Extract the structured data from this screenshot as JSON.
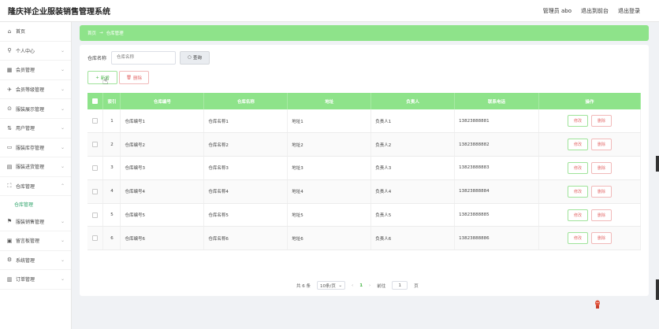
{
  "app": {
    "title": "隆庆祥企业服装销售管理系统"
  },
  "header": {
    "admin": "管理员 abo",
    "front": "退出到前台",
    "logout": "退出登录"
  },
  "sidebar": {
    "items": [
      {
        "icon": "home-icon",
        "glyph": "⌂",
        "label": "首页",
        "arrow": ""
      },
      {
        "icon": "user-icon",
        "glyph": "⚲",
        "label": "个人中心",
        "arrow": "⌄"
      },
      {
        "icon": "members-icon",
        "glyph": "▦",
        "label": "会员管理",
        "arrow": "⌄"
      },
      {
        "icon": "level-icon",
        "glyph": "✈",
        "label": "会员等级管理",
        "arrow": "⌄"
      },
      {
        "icon": "display-icon",
        "glyph": "⊙",
        "label": "服装展示管理",
        "arrow": "⌄"
      },
      {
        "icon": "users-icon",
        "glyph": "⇅",
        "label": "用户管理",
        "arrow": "⌄"
      },
      {
        "icon": "stock-icon",
        "glyph": "▭",
        "label": "服装库存管理",
        "arrow": "⌄"
      },
      {
        "icon": "purchase-icon",
        "glyph": "▤",
        "label": "服装进货管理",
        "arrow": "⌄"
      },
      {
        "icon": "warehouse-icon",
        "glyph": "⛶",
        "label": "仓库管理",
        "arrow": "⌃"
      }
    ],
    "sub_item": "仓库管理",
    "items_after": [
      {
        "icon": "sales-icon",
        "glyph": "⚑",
        "label": "服装销售管理",
        "arrow": "⌄"
      },
      {
        "icon": "message-icon",
        "glyph": "▣",
        "label": "留言板管理",
        "arrow": "⌄"
      },
      {
        "icon": "system-icon",
        "glyph": "⚙",
        "label": "系统管理",
        "arrow": "⌄"
      },
      {
        "icon": "order-icon",
        "glyph": "▥",
        "label": "订单管理",
        "arrow": "⌄"
      }
    ]
  },
  "breadcrumb": {
    "home": "首页",
    "separator": "→",
    "current": "仓库管理"
  },
  "search": {
    "label": "仓库名称",
    "placeholder": "仓库名称",
    "button": "查询"
  },
  "actions": {
    "add": "新增",
    "delete": "删除"
  },
  "table": {
    "headers": [
      "索引",
      "仓库编号",
      "仓库名称",
      "地址",
      "负责人",
      "联系电话",
      "操作"
    ],
    "edit_label": "修改",
    "delete_label": "删除",
    "rows": [
      {
        "index": "1",
        "code": "仓库编号1",
        "name": "仓库名称1",
        "address": "地址1",
        "manager": "负责人1",
        "phone": "13823888881"
      },
      {
        "index": "2",
        "code": "仓库编号2",
        "name": "仓库名称2",
        "address": "地址2",
        "manager": "负责人2",
        "phone": "13823888882"
      },
      {
        "index": "3",
        "code": "仓库编号3",
        "name": "仓库名称3",
        "address": "地址3",
        "manager": "负责人3",
        "phone": "13823888883"
      },
      {
        "index": "4",
        "code": "仓库编号4",
        "name": "仓库名称4",
        "address": "地址4",
        "manager": "负责人4",
        "phone": "13823888884"
      },
      {
        "index": "5",
        "code": "仓库编号5",
        "name": "仓库名称5",
        "address": "地址5",
        "manager": "负责人5",
        "phone": "13823888885"
      },
      {
        "index": "6",
        "code": "仓库编号6",
        "name": "仓库名称6",
        "address": "地址6",
        "manager": "负责人6",
        "phone": "13823888886"
      }
    ]
  },
  "pagination": {
    "total": "共 6 条",
    "page_size": "10条/页",
    "prev": "‹",
    "current": "1",
    "next": "›",
    "goto": "前往",
    "page_input": "1",
    "page_unit": "页"
  },
  "colors": {
    "accent": "#8ee38a",
    "active_menu": "#2fa36b",
    "danger": "#e36b6b"
  }
}
